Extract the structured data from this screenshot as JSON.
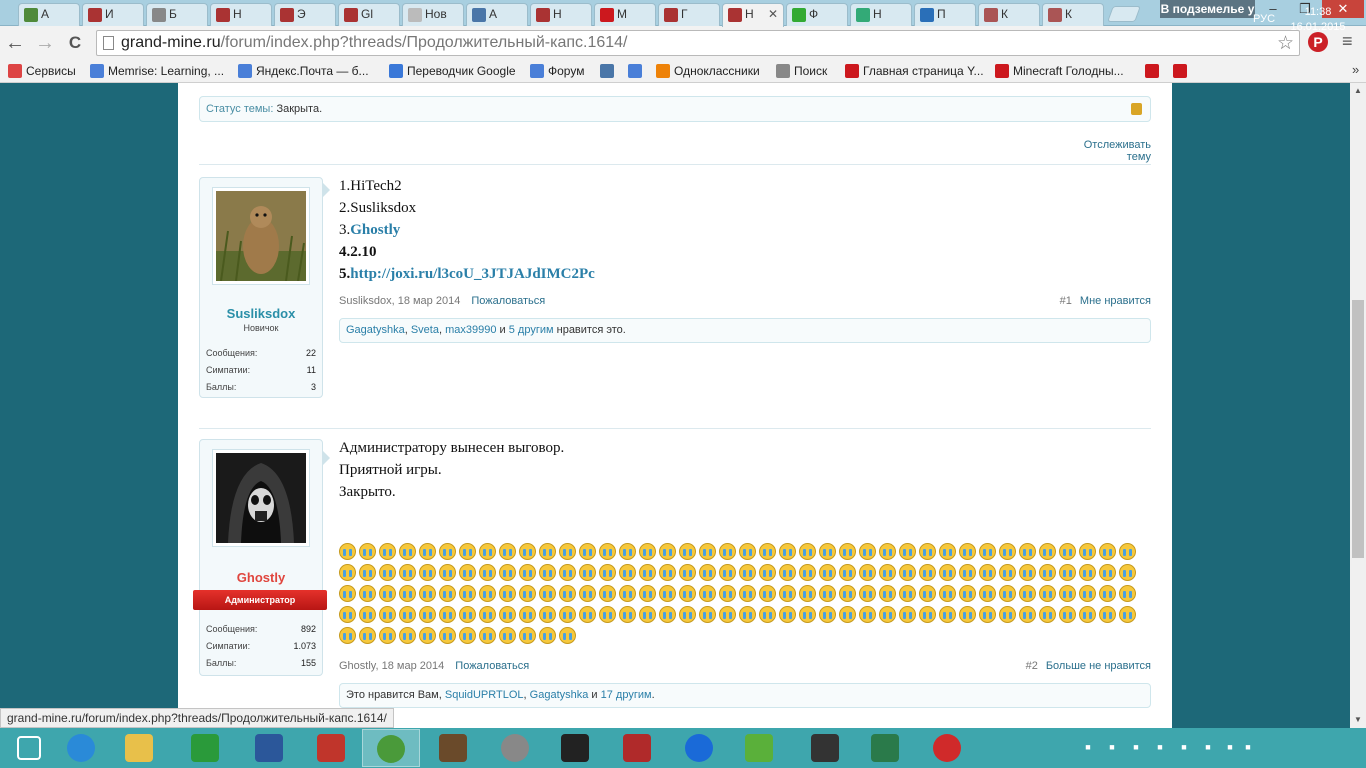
{
  "tabs": [
    {
      "label": "А",
      "icon": "owl-icon",
      "color": "#4f8a3a"
    },
    {
      "label": "И",
      "icon": "grandmine-icon",
      "color": "#a33"
    },
    {
      "label": "Б",
      "icon": "ex-icon",
      "color": "#888"
    },
    {
      "label": "Н",
      "icon": "grandmine-icon",
      "color": "#a33"
    },
    {
      "label": "Э",
      "icon": "grandmine-icon",
      "color": "#a33"
    },
    {
      "label": "Gl",
      "icon": "grandmine-icon",
      "color": "#a33"
    },
    {
      "label": "Нов",
      "icon": "blank-icon",
      "color": "#bbb"
    },
    {
      "label": "А",
      "icon": "vk-icon",
      "color": "#4a76a8"
    },
    {
      "label": "Н",
      "icon": "grandmine-icon",
      "color": "#a33"
    },
    {
      "label": "М",
      "icon": "youtube-icon",
      "color": "#cc181e"
    },
    {
      "label": "Г",
      "icon": "grandmine-icon",
      "color": "#a33"
    },
    {
      "label": "Н",
      "icon": "grandmine-icon",
      "color": "#a33",
      "active": true
    },
    {
      "label": "Ф",
      "icon": "creeper-icon",
      "color": "#3a3"
    },
    {
      "label": "Н",
      "icon": "screen-icon",
      "color": "#3a7"
    },
    {
      "label": "П",
      "icon": "info-icon",
      "color": "#2a6fb8"
    },
    {
      "label": "К",
      "icon": "cube-icon",
      "color": "#a55"
    },
    {
      "label": "К",
      "icon": "cube-icon",
      "color": "#a55"
    }
  ],
  "window": {
    "profile": "В подземелье у",
    "minimize": "–",
    "restore": "❐",
    "close": "✕"
  },
  "toolbar": {
    "back": "←",
    "forward": "→",
    "reload": "C",
    "url_domain": "grand-mine.ru",
    "url_path": "/forum/index.php?threads/Продолжительный-капс.1614/",
    "star": "☆",
    "pin": "P",
    "menu": "≡"
  },
  "bookmarks": [
    {
      "label": "Сервисы",
      "icon": "apps-icon",
      "color": "#d44"
    },
    {
      "label": "Memrise: Learning, ...",
      "icon": "google-icon",
      "color": "#4a7fd8"
    },
    {
      "label": "Яндекс.Почта — б...",
      "icon": "google-icon",
      "color": "#4a7fd8"
    },
    {
      "label": "Переводчик Google",
      "icon": "translate-icon",
      "color": "#3a78d8"
    },
    {
      "label": "Форум",
      "icon": "google-icon",
      "color": "#4a7fd8"
    },
    {
      "label": "",
      "icon": "vk-icon",
      "color": "#4a76a8"
    },
    {
      "label": "",
      "icon": "google-icon",
      "color": "#4a7fd8"
    },
    {
      "label": "Одноклассники",
      "icon": "ok-icon",
      "color": "#ee8208"
    },
    {
      "label": "Поиск",
      "icon": "ex-icon",
      "color": "#888"
    },
    {
      "label": "Главная страница Y...",
      "icon": "youtube-icon",
      "color": "#cc181e"
    },
    {
      "label": "Minecraft Голодны...",
      "icon": "youtube-icon",
      "color": "#cc181e"
    },
    {
      "label": "",
      "icon": "youtube-icon",
      "color": "#cc181e"
    },
    {
      "label": "",
      "icon": "youtube-icon",
      "color": "#cc181e"
    }
  ],
  "bookmarks_more": "»",
  "thread": {
    "status_label": "Статус темы:",
    "status_value": "Закрыта.",
    "follow": "Отслеживать тему"
  },
  "posts": [
    {
      "username": "Susliksdox",
      "username_color": "#2a8fa8",
      "user_title": "Новичок",
      "stats": [
        {
          "label": "Сообщения:",
          "value": "22"
        },
        {
          "label": "Симпатии:",
          "value": "11"
        },
        {
          "label": "Баллы:",
          "value": "3"
        }
      ],
      "lines": [
        "1.HiTech2",
        "2.Susliksdox",
        "3.",
        "Ghostly",
        "4.2.10",
        "5.",
        "http://joxi.ru/l3coU_3JTJAJdIMC2Pc"
      ],
      "author": "Susliksdox",
      "date": "18 мар 2014",
      "report": "Пожаловаться",
      "number": "#1",
      "like_action": "Мне нравится",
      "likes": {
        "users": [
          "Gagatyshka",
          "Sveta",
          "max39990"
        ],
        "and": "и",
        "others": "5 другим",
        "suffix": "нравится это."
      }
    },
    {
      "username": "Ghostly",
      "username_color": "#e0463e",
      "badge": "Администратор",
      "stats": [
        {
          "label": "Сообщения:",
          "value": "892"
        },
        {
          "label": "Симпатии:",
          "value": "1.073"
        },
        {
          "label": "Баллы:",
          "value": "155"
        }
      ],
      "lines": [
        "Администратору вынесен выговор.",
        "Приятной игры.",
        "Закрыто."
      ],
      "emoji": {
        "name": "crying-face",
        "rows": [
          40,
          40,
          40,
          40,
          12
        ]
      },
      "author": "Ghostly",
      "date": "18 мар 2014",
      "report": "Пожаловаться",
      "number": "#2",
      "like_action": "Больше не нравится",
      "likes": {
        "prefix": "Это нравится Вам,",
        "users": [
          "SquidUPRTLOL",
          "Gagatyshka"
        ],
        "and": "и",
        "others": "17 другим",
        "suffix": "."
      }
    }
  ],
  "hover_url": "grand-mine.ru/forum/index.php?threads/Продолжительный-капс.1614/",
  "taskbar": {
    "apps": [
      {
        "icon": "windows-start-icon",
        "color": "#3ea6ad"
      },
      {
        "icon": "internet-explorer-icon",
        "color": "#2a8ad8"
      },
      {
        "icon": "file-explorer-icon",
        "color": "#e8c04a"
      },
      {
        "icon": "store-icon",
        "color": "#2a9a3a"
      },
      {
        "icon": "word-icon",
        "color": "#2b579a"
      },
      {
        "icon": "game-icon",
        "color": "#c0352b"
      },
      {
        "icon": "chrome-icon",
        "color": "#4a9a3a",
        "active": true
      },
      {
        "icon": "minecraft-icon",
        "color": "#6a4a2a"
      },
      {
        "icon": "gm-launcher-icon",
        "color": "#888"
      },
      {
        "icon": "cr-icon",
        "color": "#222"
      },
      {
        "icon": "launcher-icon",
        "color": "#b02a2a"
      },
      {
        "icon": "flash-icon",
        "color": "#1a6ad8"
      },
      {
        "icon": "creeper-icon",
        "color": "#5ab03a"
      },
      {
        "icon": "skull-icon",
        "color": "#333"
      },
      {
        "icon": "s-launcher-icon",
        "color": "#2a7a4a"
      },
      {
        "icon": "pokeball-icon",
        "color": "#d02a2a"
      }
    ],
    "tray": [
      "chrome-tray-icon",
      "recycle-icon",
      "monitor-icon",
      "flag-icon",
      "network-icon",
      "snowflake-icon",
      "battery-icon",
      "wifi-icon",
      "volume-icon"
    ],
    "lang": "РУС",
    "time": "11:38",
    "date": "16.01.2015"
  }
}
